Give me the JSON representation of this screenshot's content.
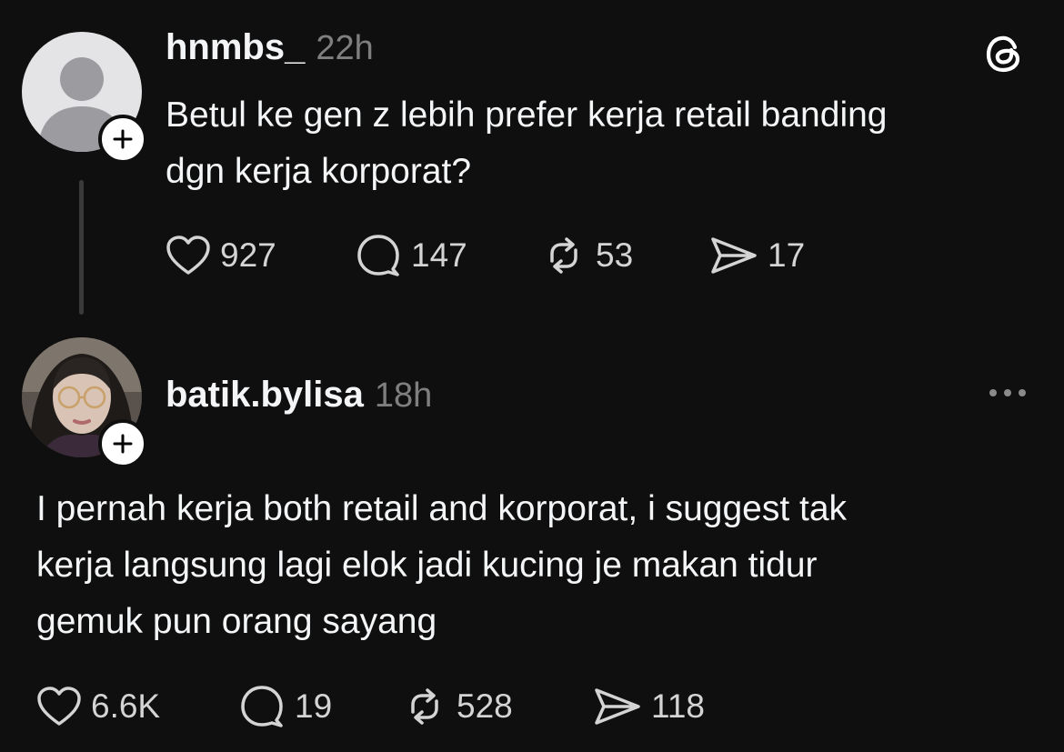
{
  "post": {
    "username": "hnmbs_",
    "time": "22h",
    "text_line1": "Betul ke gen z lebih prefer kerja retail banding",
    "text_line2": "dgn kerja korporat?",
    "likes": "927",
    "comments": "147",
    "reposts": "53",
    "shares": "17"
  },
  "reply": {
    "username": "batik.bylisa",
    "time": "18h",
    "text_line1": "I pernah kerja both retail and korporat, i suggest tak",
    "text_line2": "kerja langsung lagi elok jadi kucing je makan tidur",
    "text_line3": "gemuk pun orang sayang",
    "likes": "6.6K",
    "comments": "19",
    "reposts": "528",
    "shares": "118"
  },
  "icons": [
    "threads-logo-icon",
    "plus-icon",
    "heart-icon",
    "comment-icon",
    "repost-icon",
    "share-icon",
    "more-icon"
  ]
}
